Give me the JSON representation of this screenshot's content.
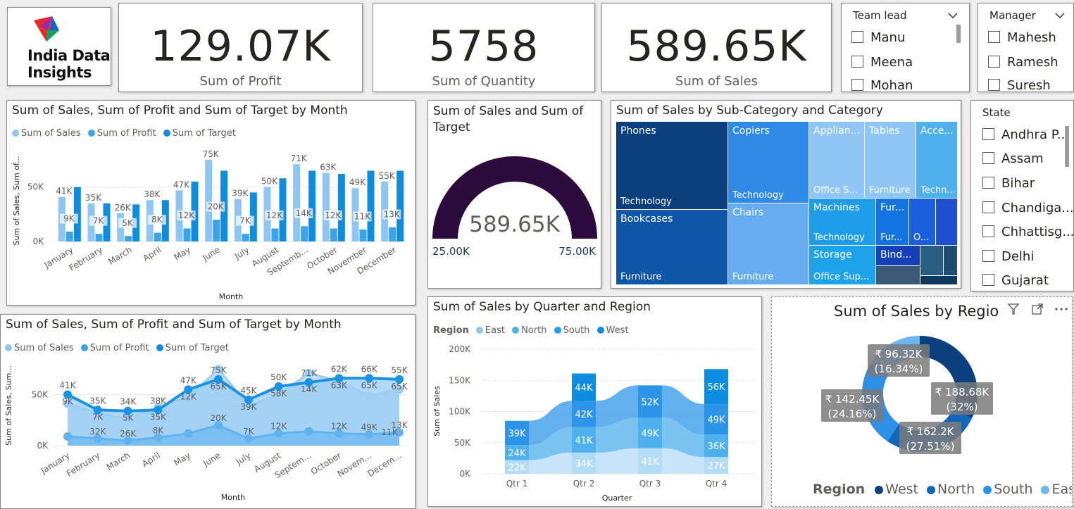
{
  "logo": {
    "line1": "India Data",
    "line2": "Insights"
  },
  "kpis": {
    "profit": {
      "value": "129.07K",
      "label": "Sum of Profit"
    },
    "quantity": {
      "value": "5758",
      "label": "Sum of Quantity"
    },
    "sales": {
      "value": "589.65K",
      "label": "Sum of Sales"
    }
  },
  "slicers": {
    "team_lead": {
      "title": "Team lead",
      "items": [
        "Manu",
        "Meena",
        "Mohan"
      ]
    },
    "manager": {
      "title": "Manager",
      "items": [
        "Mahesh",
        "Ramesh",
        "Suresh"
      ]
    },
    "state": {
      "title": "State",
      "items": [
        "Andhra P...",
        "Assam",
        "Bihar",
        "Chandiga...",
        "Chhattisg...",
        "Delhi",
        "Gujarat"
      ]
    }
  },
  "colors": {
    "sales": "#8dc6f2",
    "profit": "#3aa3ea",
    "target": "#0d8ce0",
    "west": "#0b3f7e",
    "north": "#1267b8",
    "south": "#2d8fe6",
    "east": "#6db6f0",
    "gauge": "#2d0a3e"
  },
  "bar_chart": {
    "title": "Sum of Sales, Sum of Profit and Sum of Target by Month",
    "legend": [
      "Sum of Sales",
      "Sum of Profit",
      "Sum of Target"
    ],
    "ylabel": "Sum of Sales, Sum of...",
    "xlabel": "Month",
    "yticks": [
      "50K",
      "0K"
    ]
  },
  "area_chart": {
    "title": "Sum of Sales, Sum of Profit and Sum of Target by Month",
    "legend": [
      "Sum of Sales",
      "Sum of Profit",
      "Sum of Target"
    ],
    "ylabel": "Sum of Sales, Sum...",
    "xlabel": "Month",
    "yticks": [
      "50K",
      "0K"
    ]
  },
  "gauge": {
    "title": "Sum of Sales and Sum of Target",
    "value": "589.65K",
    "min": "25.00K",
    "max": "75.00K",
    "fill_fraction": 1.0
  },
  "treemap": {
    "title": "Sum of Sales by Sub-Category and Category",
    "cells": [
      {
        "label": "Phones",
        "category": "Technology"
      },
      {
        "label": "Bookcases",
        "category": "Furniture"
      },
      {
        "label": "Copiers",
        "category": "Technology"
      },
      {
        "label": "Chairs",
        "category": "Furniture"
      },
      {
        "label": "Applian...",
        "category": "Office S..."
      },
      {
        "label": "Tables",
        "category": "Furniture"
      },
      {
        "label": "Acce...",
        "category": "Techn..."
      },
      {
        "label": "Machines",
        "category": "Technology"
      },
      {
        "label": "Fur...",
        "category": "Fur..."
      },
      {
        "label": "O...",
        "category": ""
      },
      {
        "label": "Storage",
        "category": "Office Sup..."
      },
      {
        "label": "Bind...",
        "category": ""
      }
    ]
  },
  "ribbon": {
    "title": "Sum of Sales by Quarter and Region",
    "legend_title": "Region",
    "legend": [
      "East",
      "North",
      "South",
      "West"
    ],
    "ylabel": "Sum of Sales",
    "xlabel": "Quarter",
    "yticks": [
      "200K",
      "150K",
      "100K",
      "50K",
      "0K"
    ]
  },
  "donut": {
    "title": "Sum of Sales by Regio",
    "legend_title": "Region",
    "legend": [
      "West",
      "North",
      "South",
      "East"
    ]
  },
  "chart_data": [
    {
      "type": "bar",
      "title": "Sum of Sales, Sum of Profit and Sum of Target by Month",
      "categories": [
        "January",
        "February",
        "March",
        "April",
        "May",
        "June",
        "July",
        "August",
        "Septemb...",
        "October",
        "November",
        "December"
      ],
      "series": [
        {
          "name": "Sum of Sales",
          "values": [
            41,
            35,
            26,
            38,
            47,
            75,
            39,
            50,
            71,
            63,
            49,
            55
          ]
        },
        {
          "name": "Sum of Profit",
          "values": [
            9,
            7,
            5,
            8,
            12,
            20,
            7,
            12,
            14,
            12,
            11,
            13
          ]
        },
        {
          "name": "Sum of Target",
          "values": [
            50,
            35,
            34,
            38,
            55,
            65,
            45,
            58,
            65,
            62,
            65,
            65
          ]
        }
      ],
      "value_labels_sales": [
        "41K",
        "35K",
        "26K",
        "38K",
        "47K",
        "75K",
        "39K",
        "50K",
        "71K",
        "63K",
        "49K",
        "55K"
      ],
      "value_labels_profit": [
        "9K",
        "7K",
        "5K",
        "8K",
        "12K",
        "20K",
        "7K",
        "12K",
        "14K",
        "12K",
        "11K",
        "13K"
      ],
      "unit": "K",
      "ylim": [
        0,
        75
      ]
    },
    {
      "type": "area",
      "title": "Sum of Sales, Sum of Profit and Sum of Target by Month",
      "categories": [
        "January",
        "February",
        "March",
        "April",
        "May",
        "June",
        "July",
        "August",
        "Septem...",
        "October",
        "Novem...",
        "Decem..."
      ],
      "series": [
        {
          "name": "Sum of Sales",
          "values": [
            41,
            32,
            26,
            38,
            47,
            75,
            39,
            50,
            71,
            63,
            49,
            55
          ]
        },
        {
          "name": "Sum of Profit",
          "values": [
            9,
            7,
            5,
            8,
            12,
            20,
            7,
            12,
            14,
            12,
            11,
            13
          ]
        },
        {
          "name": "Sum of Target",
          "values": [
            50,
            35,
            34,
            35,
            55,
            65,
            45,
            58,
            62,
            66,
            66,
            65
          ]
        }
      ],
      "labels": {
        "top": [
          "41K",
          "35K",
          "34K",
          "38K",
          "47K",
          "75K",
          "45K",
          "50K",
          "71K",
          "62K",
          "66K",
          "55K"
        ],
        "mid": [
          "9K",
          "7K",
          "5K",
          "35K",
          "12K",
          "65K",
          "39K",
          "58K",
          "14K",
          "63K",
          "65K",
          "65K"
        ],
        "low": [
          "",
          "32K",
          "26K",
          "8K",
          "",
          "20K",
          "7K",
          "12K",
          "",
          "12K",
          "49K",
          "13K"
        ],
        "extra": [
          "",
          "",
          "",
          "",
          "",
          "",
          "",
          "",
          "",
          "",
          "",
          "11K"
        ]
      },
      "unit": "K",
      "ylim": [
        0,
        80
      ]
    },
    {
      "type": "area",
      "subtype": "ribbon",
      "title": "Sum of Sales by Quarter and Region",
      "categories": [
        "Qtr 1",
        "Qtr 2",
        "Qtr 3",
        "Qtr 4"
      ],
      "series": [
        {
          "name": "East",
          "values": [
            22,
            34,
            41,
            27
          ]
        },
        {
          "name": "North",
          "values": [
            24,
            41,
            49,
            36
          ]
        },
        {
          "name": "South",
          "values": [
            39,
            42,
            52,
            49
          ]
        },
        {
          "name": "West",
          "values": [
            0,
            44,
            0,
            56
          ]
        }
      ],
      "segment_labels": [
        [
          "22K",
          "24K",
          "39K"
        ],
        [
          "34K",
          "41K",
          "42K",
          "44K"
        ],
        [
          "41K",
          "49K",
          "52K"
        ],
        [
          "27K",
          "36K",
          "49K",
          "56K"
        ]
      ],
      "unit": "K",
      "ylim": [
        0,
        200
      ]
    },
    {
      "type": "pie",
      "subtype": "donut",
      "title": "Sum of Sales by Regio",
      "categories": [
        "West",
        "North",
        "South",
        "East"
      ],
      "values": [
        188.68,
        162.2,
        142.45,
        96.32
      ],
      "labels": [
        [
          "₹ 188.68K",
          "(32%)"
        ],
        [
          "₹ 162.2K",
          "(27.51%)"
        ],
        [
          "₹ 142.45K",
          "(24.16%)"
        ],
        [
          "₹ 96.32K",
          "(16.34%)"
        ]
      ],
      "percent": [
        32,
        27.51,
        24.16,
        16.34
      ]
    }
  ]
}
